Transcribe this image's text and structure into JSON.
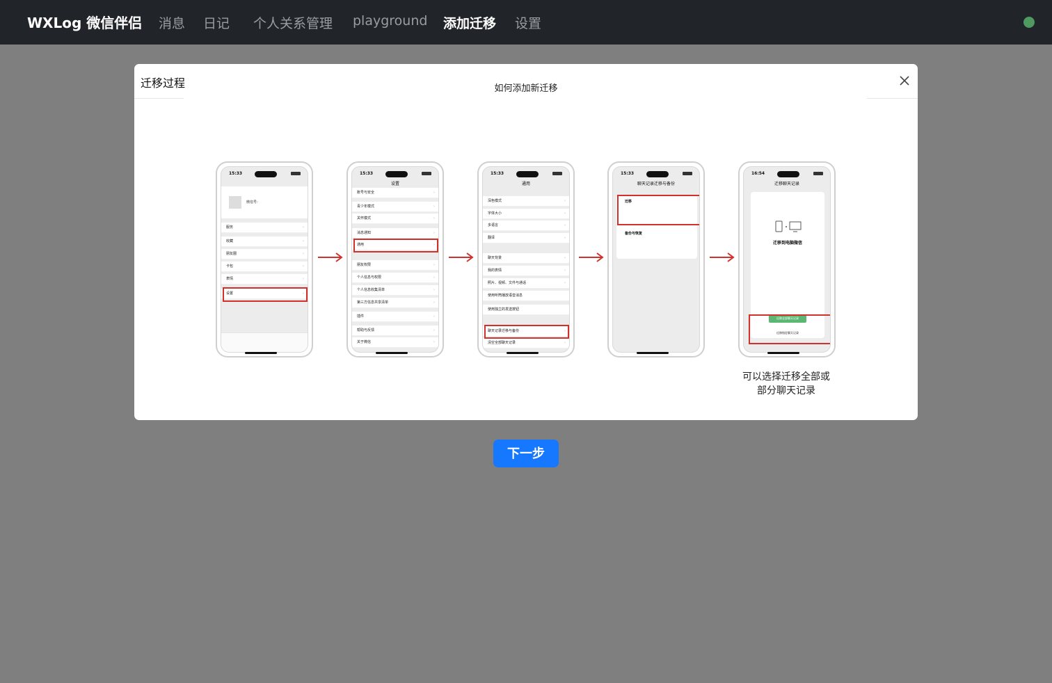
{
  "navbar": {
    "brand": "WXLog 微信伴侣",
    "items": [
      {
        "label": "消息",
        "active": false
      },
      {
        "label": "日记",
        "active": false
      },
      {
        "label": "个人关系管理",
        "active": false
      },
      {
        "label": "playground",
        "active": false
      },
      {
        "label": "添加迁移",
        "active": true
      },
      {
        "label": "设置",
        "active": false
      }
    ],
    "status_color": "#4e9a5f"
  },
  "modal": {
    "title": "迁移过程",
    "content_title": "如何添加新迁移",
    "close_icon": "close-icon",
    "step_note_line1": "可以选择迁移全部或",
    "step_note_line2": "部分聊天记录",
    "phones": [
      {
        "time": "15:33",
        "header": "",
        "rows": [
          "微信号:",
          "服务",
          "收藏",
          "朋友圈",
          "卡包",
          "表情",
          "设置"
        ],
        "highlight": "设置"
      },
      {
        "time": "15:33",
        "header": "设置",
        "rows": [
          "账号与安全",
          "青少年模式",
          "关怀模式",
          "消息通知",
          "通用",
          "朋友权限",
          "个人信息与权限",
          "个人信息收集清单",
          "第三方信息共享清单",
          "插件",
          "帮助与反馈",
          "关于微信"
        ],
        "highlight": "通用"
      },
      {
        "time": "15:33",
        "header": "通用",
        "rows": [
          "深色模式",
          "字体大小",
          "多语言",
          "翻译",
          "聊天背景",
          "我的表情",
          "照片、视频、文件与通话",
          "使用听筒播放语音消息",
          "使用独立的发送按钮",
          "聊天记录迁移与备份",
          "清空全部聊天记录"
        ],
        "highlight": "聊天记录迁移与备份"
      },
      {
        "time": "15:33",
        "header": "聊天记录迁移与备份",
        "rows": [
          "迁移",
          "备份与恢复"
        ],
        "highlight": "迁移"
      },
      {
        "time": "16:54",
        "header": "迁移聊天记录",
        "rows": [
          "迁移到电脑微信",
          "迁移全部聊天记录",
          "迁移指定聊天记录"
        ],
        "highlight": "迁移全部聊天记录"
      }
    ]
  },
  "next_button": {
    "label": "下一步"
  },
  "colors": {
    "accent": "#1677ff",
    "highlight": "#d0322b",
    "navbar": "#212529",
    "backdrop": "#7f7f7f"
  }
}
